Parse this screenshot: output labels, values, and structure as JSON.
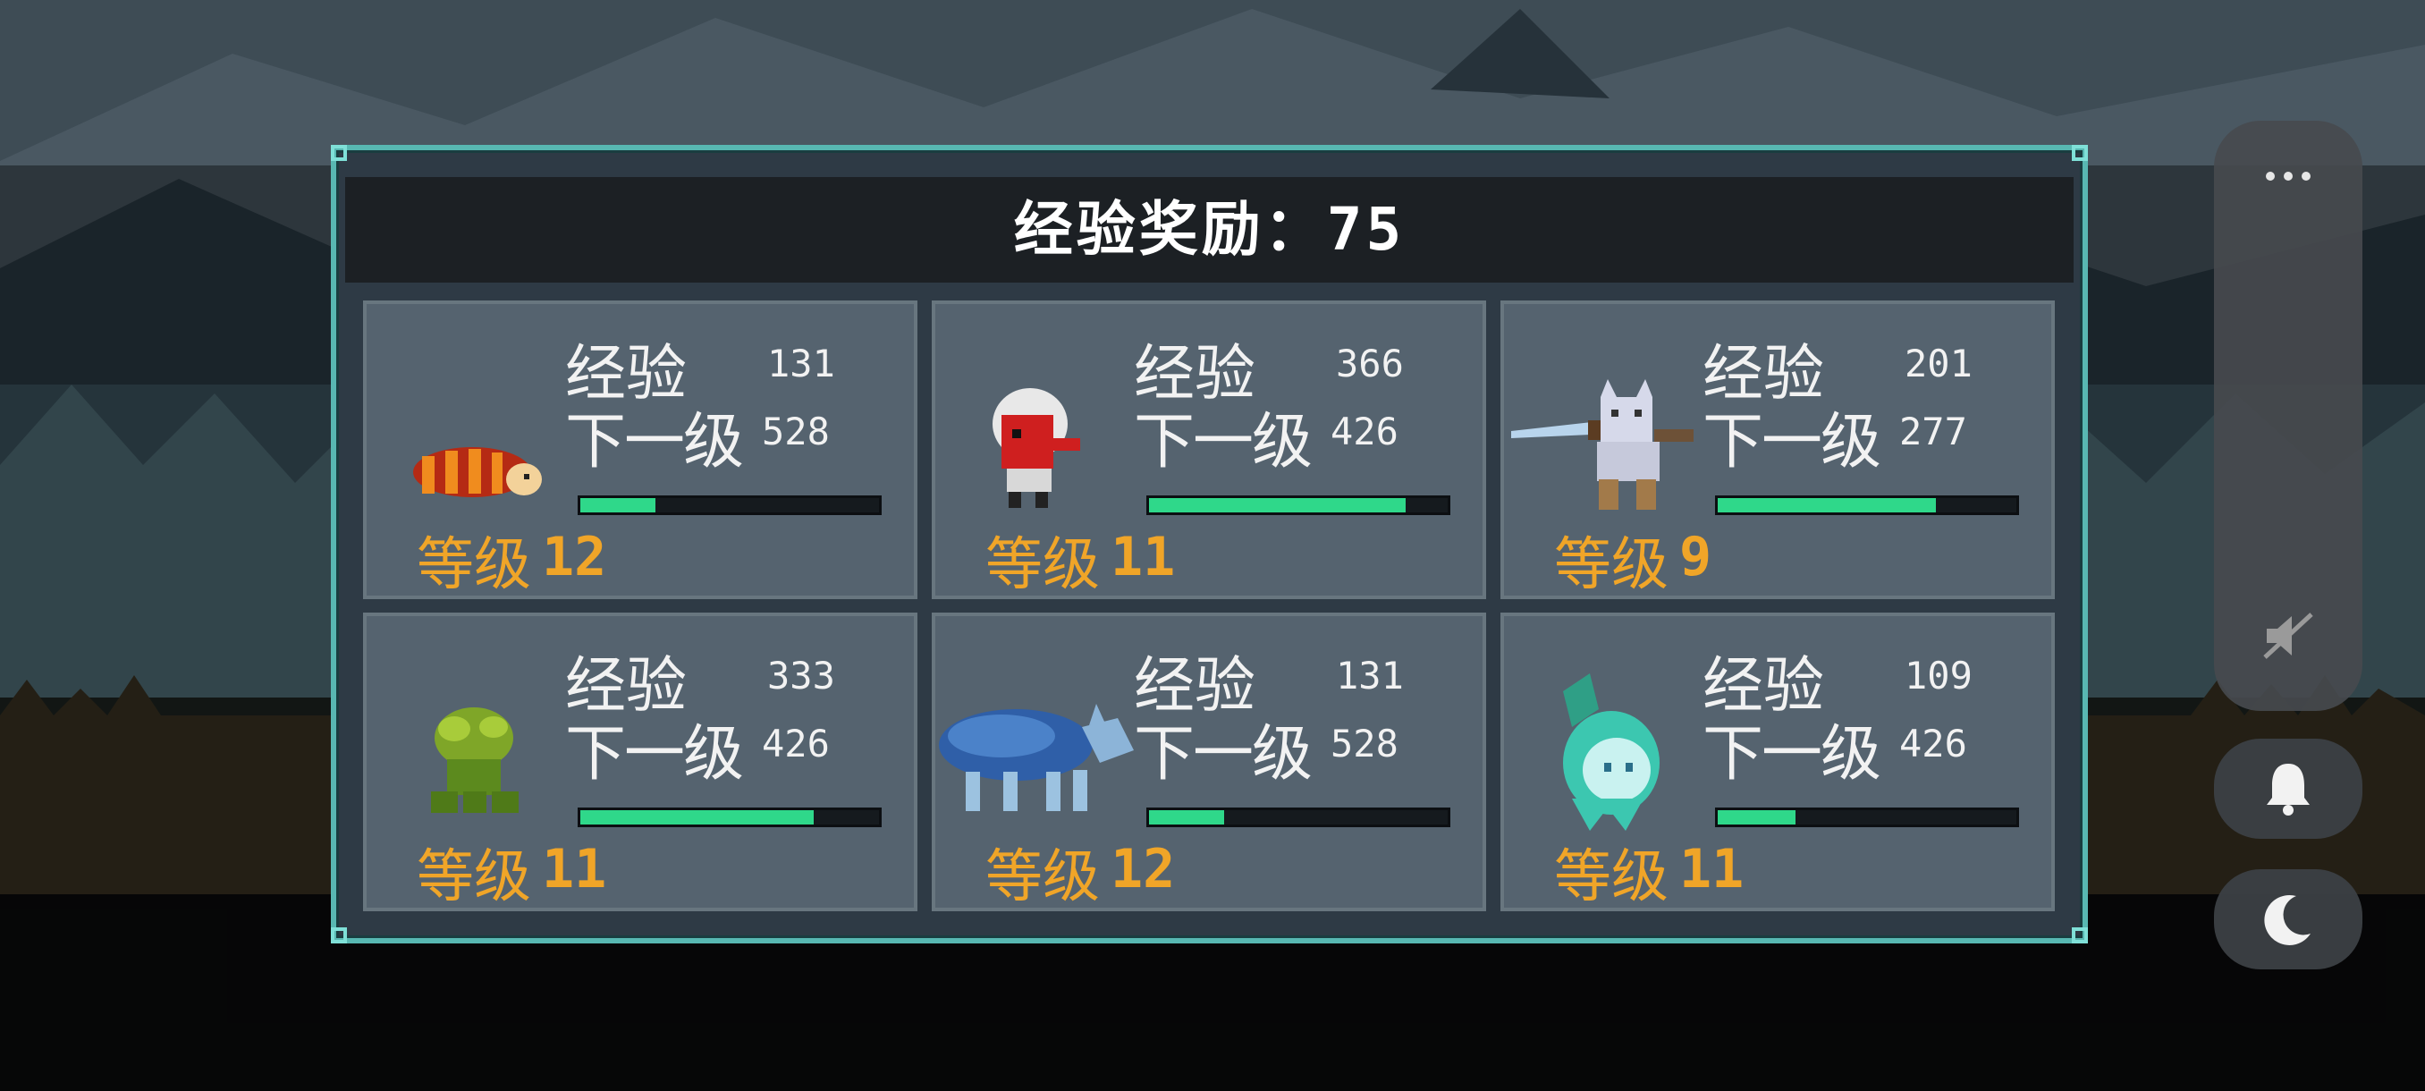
{
  "header": {
    "title": "经验奖励：75"
  },
  "labels": {
    "exp": "经验",
    "next": "下一级",
    "level": "等级"
  },
  "colors": {
    "accent_border": "#58b8b2",
    "bar_fill": "#2fd88a",
    "level_text": "#f0a528"
  },
  "party": [
    {
      "creature": "red-striped-grub",
      "exp": "131",
      "next": "528",
      "level": "12",
      "progress": 0.25
    },
    {
      "creature": "red-tribal-mask-warrior",
      "exp": "366",
      "next": "426",
      "level": "11",
      "progress": 0.86
    },
    {
      "creature": "white-cat-swordsman",
      "exp": "201",
      "next": "277",
      "level": "9",
      "progress": 0.73
    },
    {
      "creature": "green-leafy-plant",
      "exp": "333",
      "next": "426",
      "level": "11",
      "progress": 0.78
    },
    {
      "creature": "blue-spectral-wolf",
      "exp": "131",
      "next": "528",
      "level": "12",
      "progress": 0.25
    },
    {
      "creature": "cyan-ghost-flame",
      "exp": "109",
      "next": "426",
      "level": "11",
      "progress": 0.26
    }
  ],
  "side_controls": {
    "more": "more-dots-icon",
    "mute": "mute-icon",
    "notify": "bell-icon",
    "night": "moon-icon"
  }
}
